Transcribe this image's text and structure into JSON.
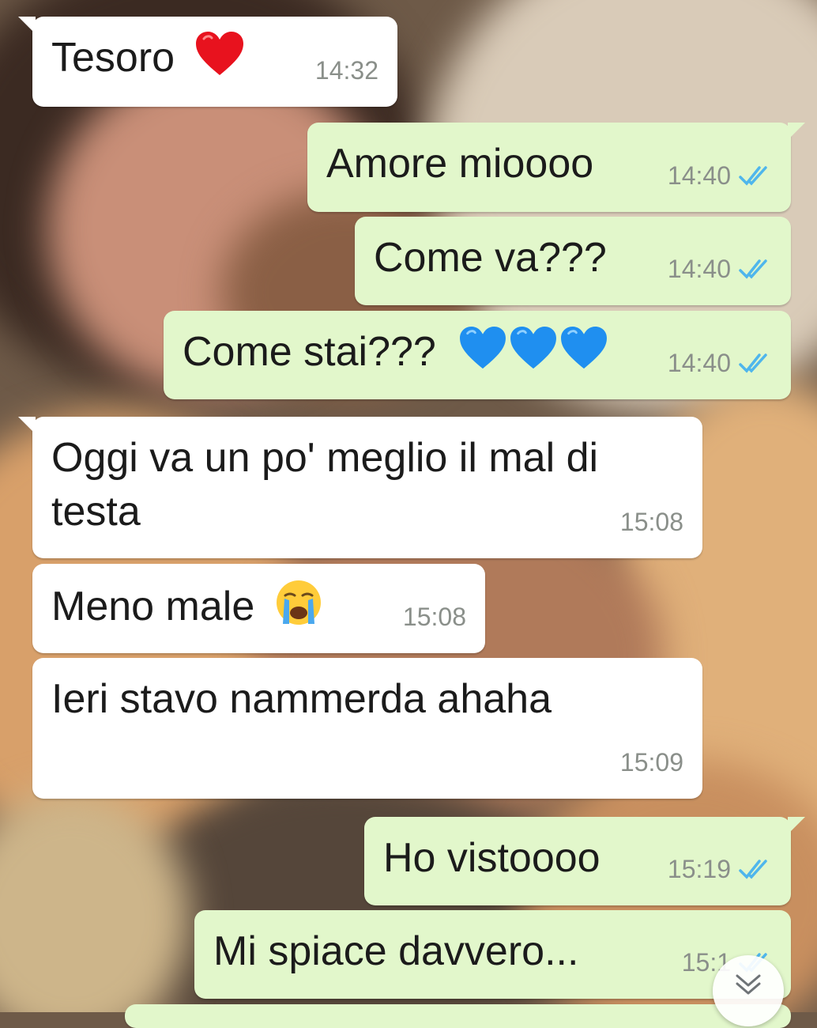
{
  "messages": [
    {
      "text": "Tesoro",
      "time": "14:32"
    },
    {
      "text": "Amore mioooo",
      "time": "14:40"
    },
    {
      "text": "Come va???",
      "time": "14:40"
    },
    {
      "text": "Come stai???",
      "time": "14:40"
    },
    {
      "text": "Oggi va un po' meglio il mal di\ntesta",
      "time": "15:08"
    },
    {
      "text": "Meno male",
      "time": "15:08"
    },
    {
      "text": "Ieri stavo nammerda ahaha",
      "time": "15:09"
    },
    {
      "text": "Ho vistoooo",
      "time": "15:19"
    },
    {
      "text": "Mi spiace davvero...",
      "time": "15:1"
    }
  ],
  "icons": {
    "read_receipt": "double-check-icon",
    "heart": "red-heart-icon",
    "blue_heart": "blue-heart-icon",
    "crying": "crying-face-icon",
    "scroll": "double-chevron-down-icon"
  },
  "colors": {
    "incoming_bubble": "#ffffff",
    "outgoing_bubble": "#e2f7cb",
    "read_ticks": "#4fb6ec",
    "time_text": "#8a8f8a"
  }
}
